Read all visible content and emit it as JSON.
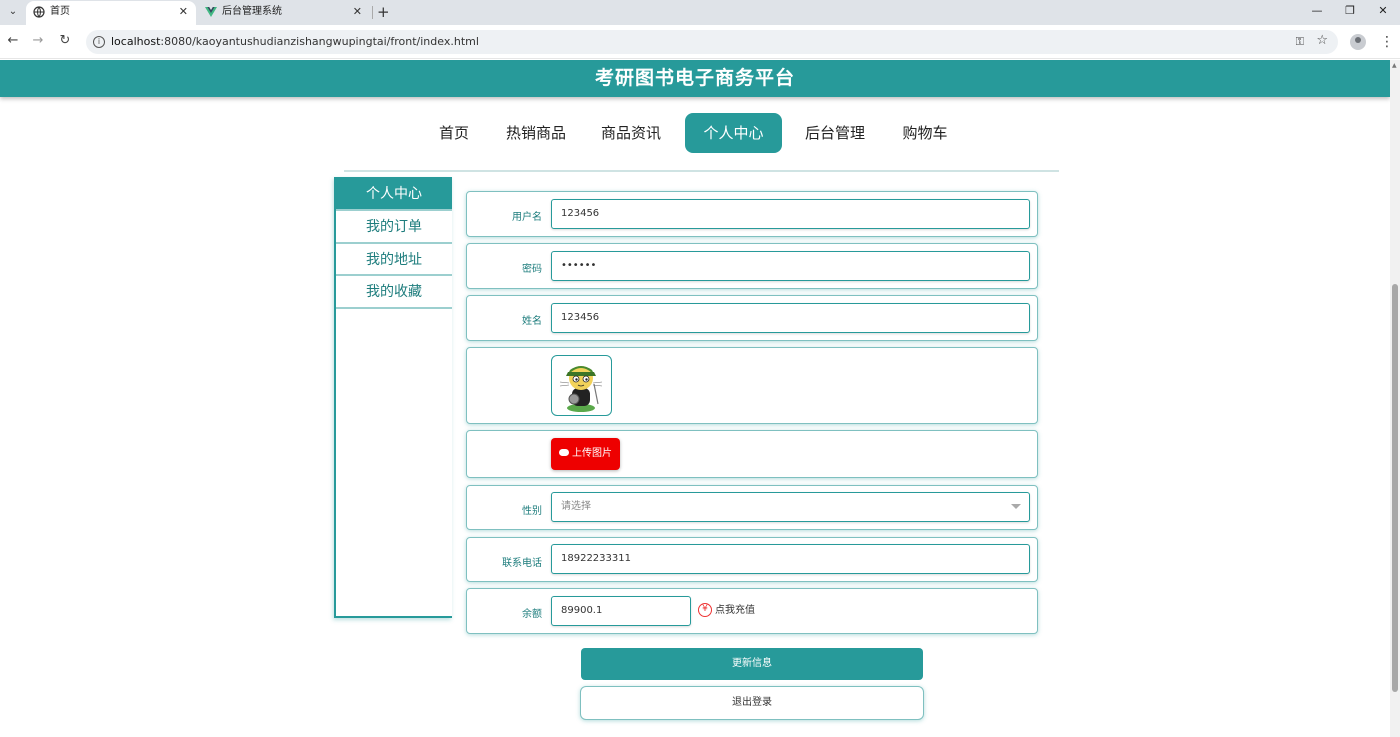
{
  "browser": {
    "tabs": [
      {
        "title": "首页",
        "active": true
      },
      {
        "title": "后台管理系统",
        "active": false
      }
    ],
    "url_host": "localhost",
    "url_rest": ":8080/kaoyantushudianzishangwupingtai/front/index.html"
  },
  "site": {
    "title": "考研图书电子商务平台",
    "accent_color": "#279a9a"
  },
  "nav": {
    "items": [
      {
        "label": "首页"
      },
      {
        "label": "热销商品"
      },
      {
        "label": "商品资讯"
      },
      {
        "label": "个人中心",
        "active": true
      },
      {
        "label": "后台管理"
      },
      {
        "label": "购物车"
      }
    ]
  },
  "sidebar": {
    "items": [
      {
        "label": "个人中心",
        "active": true
      },
      {
        "label": "我的订单"
      },
      {
        "label": "我的地址"
      },
      {
        "label": "我的收藏"
      }
    ]
  },
  "form": {
    "username": {
      "label": "用户名",
      "value": "123456"
    },
    "password": {
      "label": "密码",
      "value": "••••••"
    },
    "name": {
      "label": "姓名",
      "value": "123456"
    },
    "upload_label": "上传图片",
    "gender": {
      "label": "性别",
      "placeholder": "请选择"
    },
    "phone": {
      "label": "联系电话",
      "value": "18922233311"
    },
    "balance": {
      "label": "余额",
      "value": "89900.1",
      "recharge_label": "点我充值"
    },
    "update_button": "更新信息",
    "logout_button": "退出登录"
  }
}
